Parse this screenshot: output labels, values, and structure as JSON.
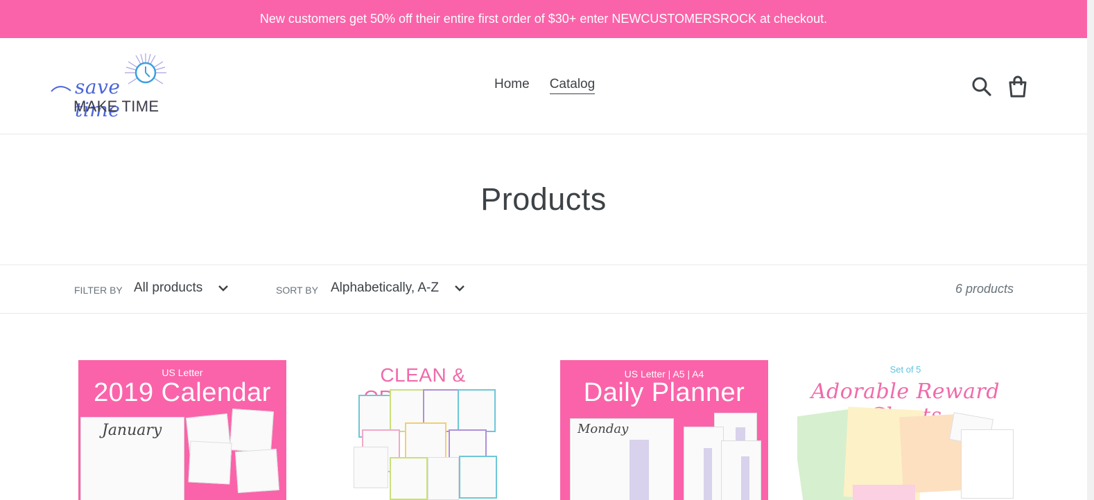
{
  "announcement": "New customers get 50% off their entire first order of $30+ enter NEWCUSTOMERSROCK at checkout.",
  "logo": {
    "script": "save time",
    "caps": "MAKE TIME"
  },
  "nav": {
    "home": "Home",
    "catalog": "Catalog"
  },
  "icons": {
    "search": "search-icon",
    "cart": "cart-icon"
  },
  "page": {
    "title": "Products"
  },
  "filters": {
    "filter_label": "Filter by",
    "filter_value": "All products",
    "sort_label": "Sort by",
    "sort_value": "Alphabetically, A-Z",
    "count": "6 products"
  },
  "products": [
    {
      "top_line": "US Letter",
      "heading": "2019 Calendar",
      "sheet_text": "January"
    },
    {
      "heading": "CLEAN & ORGANIZED"
    },
    {
      "top_line": "US Letter | A5 | A4",
      "heading": "Daily Planner",
      "sheet_text": "Monday"
    },
    {
      "top_line": "Set of 5",
      "heading": "Adorable Reward Charts"
    }
  ],
  "colors": {
    "accent": "#fa63a9",
    "text": "#3d4246",
    "muted": "#69727b",
    "border": "#e8e9eb"
  }
}
